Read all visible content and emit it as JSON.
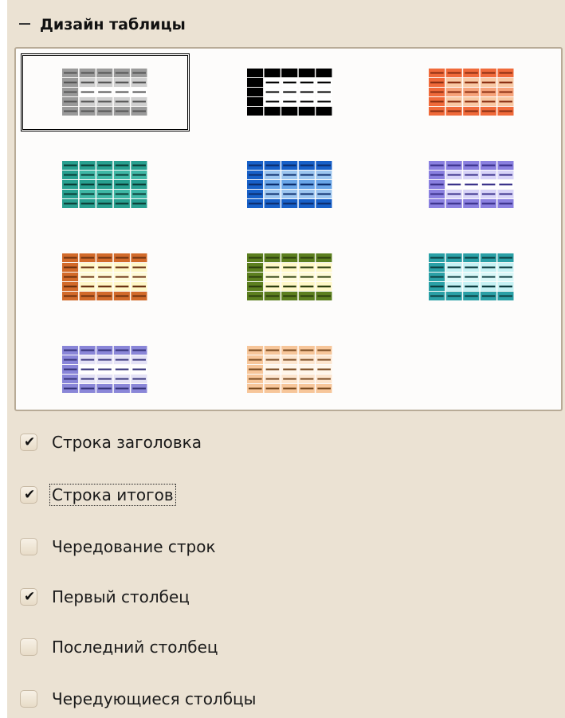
{
  "panel": {
    "title": "Дизайн таблицы",
    "collapse_icon": "collapse-minus-icon"
  },
  "table_styles": [
    {
      "name": "gray",
      "selected": true,
      "header": "#9a9a9a",
      "stripe": "#cfcfcf",
      "body": "#ffffff",
      "line": "#555555",
      "first_col": "#9a9a9a"
    },
    {
      "name": "black",
      "selected": false,
      "header": "#000000",
      "stripe": "#ffffff",
      "body": "#ffffff",
      "line": "#000000",
      "first_col": "#000000"
    },
    {
      "name": "orange-red",
      "selected": false,
      "header": "#f06a3a",
      "stripe": "#f9c9a4",
      "body": "#f7a37a",
      "line": "#8a2f12",
      "first_col": "#f06a3a"
    },
    {
      "name": "teal",
      "selected": false,
      "header": "#28a090",
      "stripe": "#3fb8a6",
      "body": "#28a090",
      "line": "#0b3c35",
      "first_col": "#28a090"
    },
    {
      "name": "blue",
      "selected": false,
      "header": "#1760c8",
      "stripe": "#9cc6f0",
      "body": "#6aa6e8",
      "line": "#0c2d6b",
      "first_col": "#1760c8"
    },
    {
      "name": "lavender",
      "selected": false,
      "header": "#8a80e0",
      "stripe": "#d8d4f8",
      "body": "#ffffff",
      "line": "#3a318a",
      "first_col": "#8a80e0"
    },
    {
      "name": "brown-yellow",
      "selected": false,
      "header": "#d26a2a",
      "stripe": "#fff8c8",
      "body": "#fffbd8",
      "line": "#6a3010",
      "first_col": "#d26a2a"
    },
    {
      "name": "green",
      "selected": false,
      "header": "#5c7f1f",
      "stripe": "#fff8c8",
      "body": "#fffbd8",
      "line": "#2b3c0c",
      "first_col": "#5c7f1f"
    },
    {
      "name": "cyan",
      "selected": false,
      "header": "#2aa0a6",
      "stripe": "#c6f2f4",
      "body": "#d9f8f8",
      "line": "#0a3b3e",
      "first_col": "#2aa0a6"
    },
    {
      "name": "periwinkle",
      "selected": false,
      "header": "#8a86d8",
      "stripe": "#e4e2f6",
      "body": "#ffffff",
      "line": "#36337a",
      "first_col": "#8a86d8"
    },
    {
      "name": "peach",
      "selected": false,
      "header": "#f7c69a",
      "stripe": "#fde6cf",
      "body": "#fff6ea",
      "line": "#7a4a20",
      "first_col": "#f7c69a"
    }
  ],
  "options": [
    {
      "label": "Строка заголовка",
      "checked": true,
      "focused": false
    },
    {
      "label": "Строка итогов",
      "checked": true,
      "focused": true
    },
    {
      "label": "Чередование строк",
      "checked": false,
      "focused": false
    },
    {
      "label": "Первый столбец",
      "checked": true,
      "focused": false
    },
    {
      "label": "Последний столбец",
      "checked": false,
      "focused": false
    },
    {
      "label": "Чередующиеся столбцы",
      "checked": false,
      "focused": false
    }
  ],
  "colors": {
    "panel_bg": "#ebe2d3",
    "grid_bg": "#fdfcfb",
    "grid_border": "#b8ab97"
  }
}
